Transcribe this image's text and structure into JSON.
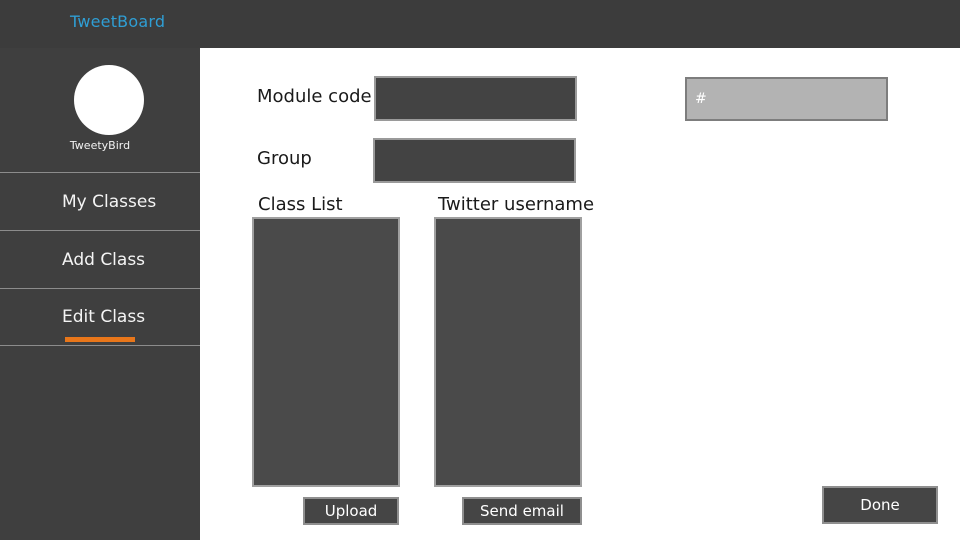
{
  "app": {
    "title": "TweetBoard",
    "accent_blue": "#2f9ed4",
    "accent_orange": "#e8761a",
    "sidebar_bg": "#3f3f3f",
    "topbar_bg": "#3c3c3c",
    "content_bg": "#ffffff"
  },
  "sidebar": {
    "profile": {
      "avatar_icon": "user-avatar-icon",
      "username": "TweetyBird"
    },
    "items": [
      {
        "label": "My Classes",
        "active": false
      },
      {
        "label": "Add Class",
        "active": false
      },
      {
        "label": "Edit Class",
        "active": true
      }
    ]
  },
  "main": {
    "fields": {
      "module_code": {
        "label": "Module code",
        "value": "",
        "placeholder": ""
      },
      "group": {
        "label": "Group",
        "value": "",
        "placeholder": ""
      },
      "hashtag": {
        "icon": "hash-icon",
        "glyph": "#",
        "value": "",
        "placeholder": ""
      }
    },
    "lists": {
      "class_list": {
        "label": "Class List",
        "items": []
      },
      "twitter_username": {
        "label": "Twitter username",
        "items": []
      }
    },
    "buttons": {
      "upload": "Upload",
      "send_email": "Send email",
      "done": "Done"
    }
  }
}
